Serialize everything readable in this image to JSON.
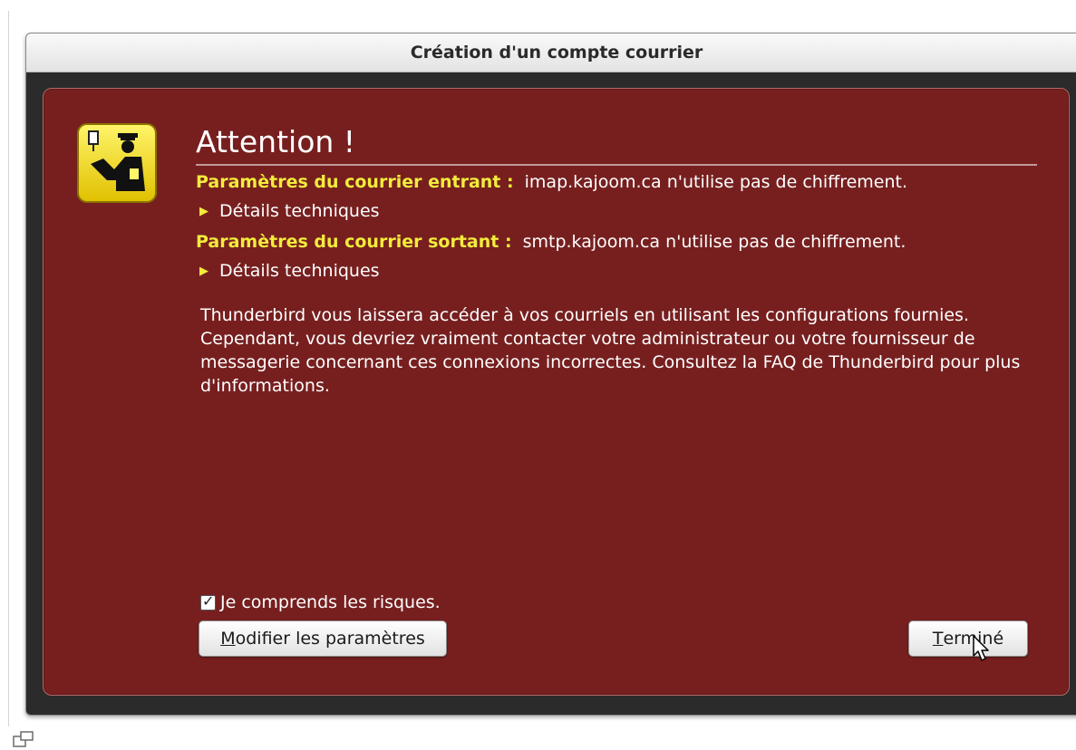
{
  "window": {
    "title": "Création d'un compte courrier"
  },
  "dialog": {
    "heading": "Attention !",
    "incoming": {
      "label": "Paramètres du courrier entrant :",
      "message": "imap.kajoom.ca n'utilise pas de chiffrement.",
      "details_label": "Détails techniques"
    },
    "outgoing": {
      "label": "Paramètres du courrier sortant :",
      "message": "smtp.kajoom.ca n'utilise pas de chiffrement.",
      "details_label": "Détails techniques"
    },
    "body": "Thunderbird vous laissera accéder à vos courriels en utilisant les configurations fournies. Cependant, vous devriez vraiment contacter votre administrateur ou votre fournisseur de messagerie concernant ces connexions incorrectes. Consultez la FAQ de Thunderbird pour plus d'informations.",
    "checkbox": {
      "label": "Je comprends les risques.",
      "checked": true
    },
    "buttons": {
      "modify_accesskey": "M",
      "modify_rest": "odifier les paramètres",
      "done_accesskey": "T",
      "done_rest": "erminé"
    },
    "icons": {
      "warning": "warning-policeman-icon",
      "expand": "triangle-right-icon",
      "cursor": "mouse-pointer-icon"
    }
  },
  "colors": {
    "panel_bg": "#771f1f",
    "label_yellow": "#f2ec3c",
    "icon_yellow": "#f2d400"
  }
}
